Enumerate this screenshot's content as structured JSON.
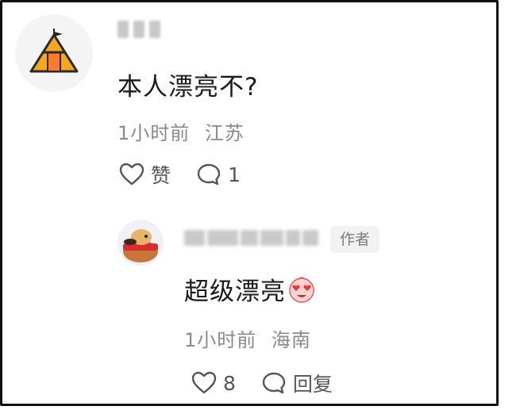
{
  "comment": {
    "text": "本人漂亮不?",
    "time": "1小时前",
    "location": "江苏",
    "like_label": "赞",
    "reply_count": "1",
    "icons": {
      "avatar": "tent-avatar",
      "like": "heart-outline-icon",
      "reply": "comment-bubble-icon"
    }
  },
  "reply": {
    "badge": "作者",
    "text": "超级漂亮",
    "time": "1小时前",
    "location": "海南",
    "like_count": "8",
    "reply_label": "回复",
    "icons": {
      "emoji": "heart-eyes-emoji",
      "like": "heart-outline-icon",
      "reply": "comment-bubble-icon"
    }
  },
  "colors": {
    "text": "#1a1a1a",
    "meta": "#8a8a8a",
    "icon": "#555555",
    "badge_bg": "#f2f2f2",
    "avatar_accent": "#f5a623"
  }
}
